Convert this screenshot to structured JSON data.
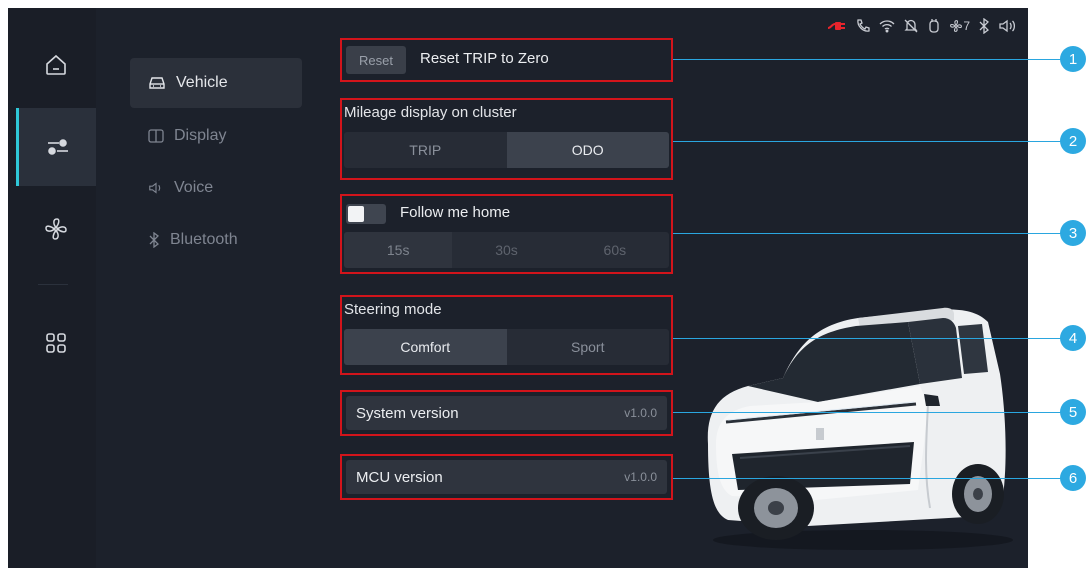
{
  "status_icons": [
    "charging-plug-icon",
    "phone-icon",
    "wifi-icon",
    "bell-off-icon",
    "seat-heat-icon",
    "fan-icon",
    "bluetooth-icon",
    "speaker-icon"
  ],
  "status_fan_level": "7",
  "rail": {
    "items": [
      {
        "icon": "home-icon"
      },
      {
        "icon": "settings-sliders-icon",
        "active": true
      },
      {
        "icon": "fan-icon"
      },
      {
        "icon": "apps-grid-icon"
      }
    ]
  },
  "subnav": {
    "items": [
      {
        "label": "Vehicle",
        "icon": "car-icon",
        "active": true
      },
      {
        "label": "Display",
        "icon": "display-icon"
      },
      {
        "label": "Voice",
        "icon": "voice-icon"
      },
      {
        "label": "Bluetooth",
        "icon": "bluetooth-icon"
      }
    ]
  },
  "trip_reset": {
    "button": "Reset",
    "label": "Reset TRIP to Zero"
  },
  "mileage": {
    "title": "Mileage display on cluster",
    "options": [
      "TRIP",
      "ODO"
    ],
    "selected": "ODO"
  },
  "follow_me_home": {
    "label": "Follow me home",
    "enabled": false,
    "options": [
      "15s",
      "30s",
      "60s"
    ],
    "selected": "15s"
  },
  "steering": {
    "title": "Steering mode",
    "options": [
      "Comfort",
      "Sport"
    ],
    "selected": "Comfort"
  },
  "system_version": {
    "label": "System version",
    "value": "v1.0.0"
  },
  "mcu_version": {
    "label": "MCU version",
    "value": "v1.0.0"
  },
  "callouts": [
    "1",
    "2",
    "3",
    "4",
    "5",
    "6"
  ],
  "colors": {
    "accent": "#2fc8d8",
    "callout": "#2da9e1",
    "highlight_box": "#d2141b",
    "background": "#1c212b"
  }
}
